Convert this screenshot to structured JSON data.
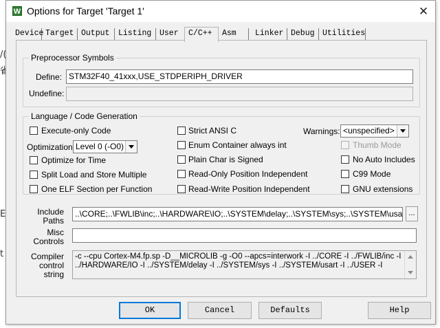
{
  "background": {
    "fragments": [
      "/(",
      "省",
      "E",
      "t"
    ]
  },
  "window": {
    "title": "Options for Target 'Target 1'",
    "app_icon_glyph": "W",
    "close_glyph": "✕"
  },
  "tabs": [
    {
      "label": "Device"
    },
    {
      "label": "Target"
    },
    {
      "label": "Output"
    },
    {
      "label": "Listing"
    },
    {
      "label": "User"
    },
    {
      "label": "C/C++",
      "active": true
    },
    {
      "label": "Asm"
    },
    {
      "label": "Linker"
    },
    {
      "label": "Debug"
    },
    {
      "label": "Utilities"
    }
  ],
  "preprocessor": {
    "title": "Preprocessor Symbols",
    "define_label": "Define:",
    "define_value": "STM32F40_41xxx,USE_STDPERIPH_DRIVER",
    "undefine_label": "Undefine:",
    "undefine_value": ""
  },
  "language": {
    "title": "Language / Code Generation",
    "options": {
      "execute_only": {
        "label": "Execute-only Code",
        "checked": false
      },
      "optimize_time": {
        "label": "Optimize for Time",
        "checked": false
      },
      "split_load": {
        "label": "Split Load and Store Multiple",
        "checked": false
      },
      "one_elf": {
        "label": "One ELF Section per Function",
        "checked": false
      },
      "strict_ansi": {
        "label": "Strict ANSI C",
        "checked": false
      },
      "enum_container": {
        "label": "Enum Container always int",
        "checked": false
      },
      "plain_char": {
        "label": "Plain Char is Signed",
        "checked": false
      },
      "ropi": {
        "label": "Read-Only Position Independent",
        "checked": false
      },
      "rwpi": {
        "label": "Read-Write Position Independent",
        "checked": false
      },
      "thumb_mode": {
        "label": "Thumb Mode",
        "checked": false,
        "disabled": true
      },
      "no_auto_includes": {
        "label": "No Auto Includes",
        "checked": false
      },
      "c99_mode": {
        "label": "C99 Mode",
        "checked": false
      },
      "gnu_extensions": {
        "label": "GNU extensions",
        "checked": false
      }
    },
    "optimization_label": "Optimization:",
    "optimization_value": "Level 0 (-O0)",
    "warnings_label": "Warnings:",
    "warnings_value": "<unspecified>"
  },
  "include_paths": {
    "label_line1": "Include",
    "label_line2": "Paths",
    "value": "..\\CORE;..\\FWLIB\\inc;..\\HARDWARE\\IO;..\\SYSTEM\\delay;..\\SYSTEM\\sys;..\\SYSTEM\\usart;..\\US",
    "browse_label": "..."
  },
  "misc_controls": {
    "label_line1": "Misc",
    "label_line2": "Controls",
    "value": ""
  },
  "compiler_string": {
    "label_line1": "Compiler",
    "label_line2": "control",
    "label_line3": "string",
    "line1": "-c --cpu Cortex-M4.fp.sp -D__MICROLIB -g -O0 --apcs=interwork -I ../CORE -I ../FWLIB/inc -I",
    "line2": "../HARDWARE/IO -I ../SYSTEM/delay -I ../SYSTEM/sys -I ../SYSTEM/usart -I ../USER -I"
  },
  "buttons": {
    "ok": "OK",
    "cancel": "Cancel",
    "defaults": "Defaults",
    "help": "Help"
  }
}
